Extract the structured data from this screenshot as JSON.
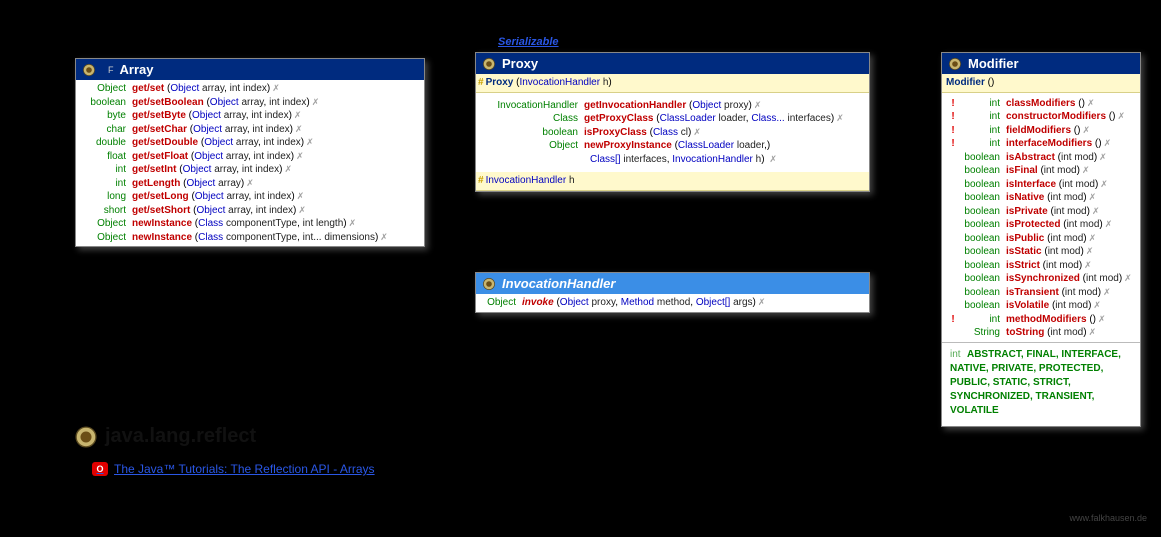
{
  "serializable": "Serializable",
  "package": {
    "name": "java.lang.reflect"
  },
  "tutorial": {
    "text": "The Java™ Tutorials: The Reflection API - Arrays"
  },
  "credit": "www.falkhausen.de",
  "array": {
    "title": "Array",
    "stereotype": "F",
    "rows": [
      {
        "ret": "Object",
        "name": "get/set",
        "args": [
          {
            "t": "Object",
            "p": "array"
          },
          {
            "t": "int",
            "p": "index"
          }
        ]
      },
      {
        "ret": "boolean",
        "name": "get/setBoolean",
        "args": [
          {
            "t": "Object",
            "p": "array"
          },
          {
            "t": "int",
            "p": "index"
          }
        ]
      },
      {
        "ret": "byte",
        "name": "get/setByte",
        "args": [
          {
            "t": "Object",
            "p": "array"
          },
          {
            "t": "int",
            "p": "index"
          }
        ]
      },
      {
        "ret": "char",
        "name": "get/setChar",
        "args": [
          {
            "t": "Object",
            "p": "array"
          },
          {
            "t": "int",
            "p": "index"
          }
        ]
      },
      {
        "ret": "double",
        "name": "get/setDouble",
        "args": [
          {
            "t": "Object",
            "p": "array"
          },
          {
            "t": "int",
            "p": "index"
          }
        ]
      },
      {
        "ret": "float",
        "name": "get/setFloat",
        "args": [
          {
            "t": "Object",
            "p": "array"
          },
          {
            "t": "int",
            "p": "index"
          }
        ]
      },
      {
        "ret": "int",
        "name": "get/setInt",
        "args": [
          {
            "t": "Object",
            "p": "array"
          },
          {
            "t": "int",
            "p": "index"
          }
        ]
      },
      {
        "ret": "int",
        "name": "getLength",
        "args": [
          {
            "t": "Object",
            "p": "array"
          }
        ]
      },
      {
        "ret": "long",
        "name": "get/setLong",
        "args": [
          {
            "t": "Object",
            "p": "array"
          },
          {
            "t": "int",
            "p": "index"
          }
        ]
      },
      {
        "ret": "short",
        "name": "get/setShort",
        "args": [
          {
            "t": "Object",
            "p": "array"
          },
          {
            "t": "int",
            "p": "index"
          }
        ]
      },
      {
        "ret": "Object",
        "name": "newInstance",
        "args": [
          {
            "t": "Class<?>",
            "p": "componentType"
          },
          {
            "t": "int",
            "p": "length"
          }
        ]
      },
      {
        "ret": "Object",
        "name": "newInstance",
        "args": [
          {
            "t": "Class<?>",
            "p": "componentType"
          },
          {
            "t": "int...",
            "p": "dimensions"
          }
        ]
      }
    ]
  },
  "proxy": {
    "title": "Proxy",
    "ctor": {
      "vis": "#",
      "name": "Proxy",
      "args": [
        {
          "t": "InvocationHandler",
          "p": "h"
        }
      ]
    },
    "rows": [
      {
        "ret": "InvocationHandler",
        "name": "getInvocationHandler",
        "args": [
          {
            "t": "Object",
            "p": "proxy"
          }
        ]
      },
      {
        "ret": "Class<?>",
        "name": "getProxyClass",
        "args": [
          {
            "t": "ClassLoader",
            "p": "loader"
          },
          {
            "t": "Class<?>...",
            "p": "interfaces"
          }
        ]
      },
      {
        "ret": "boolean",
        "name": "isProxyClass",
        "args": [
          {
            "t": "Class<?>",
            "p": "cl"
          }
        ]
      },
      {
        "ret": "Object",
        "name": "newProxyInstance",
        "args": [
          {
            "t": "ClassLoader",
            "p": "loader"
          }
        ],
        "cont": [
          {
            "t": "Class<?>[]",
            "p": "interfaces"
          },
          {
            "t": "InvocationHandler",
            "p": "h"
          }
        ]
      }
    ],
    "field": {
      "vis": "#",
      "type": "InvocationHandler",
      "name": "h"
    }
  },
  "invocationHandler": {
    "title": "InvocationHandler",
    "row": {
      "ret": "Object",
      "name": "invoke",
      "args": [
        {
          "t": "Object",
          "p": "proxy"
        },
        {
          "t": "Method",
          "p": "method"
        },
        {
          "t": "Object[]",
          "p": "args"
        }
      ]
    }
  },
  "modifier": {
    "title": "Modifier",
    "ctor": {
      "name": "Modifier",
      "args": []
    },
    "rows": [
      {
        "bang": true,
        "ret": "int",
        "name": "classModifiers",
        "args": []
      },
      {
        "bang": true,
        "ret": "int",
        "name": "constructorModifiers",
        "args": []
      },
      {
        "bang": true,
        "ret": "int",
        "name": "fieldModifiers",
        "args": []
      },
      {
        "bang": true,
        "ret": "int",
        "name": "interfaceModifiers",
        "args": []
      },
      {
        "ret": "boolean",
        "name": "isAbstract",
        "args": [
          {
            "t": "int",
            "p": "mod"
          }
        ]
      },
      {
        "ret": "boolean",
        "name": "isFinal",
        "args": [
          {
            "t": "int",
            "p": "mod"
          }
        ]
      },
      {
        "ret": "boolean",
        "name": "isInterface",
        "args": [
          {
            "t": "int",
            "p": "mod"
          }
        ]
      },
      {
        "ret": "boolean",
        "name": "isNative",
        "args": [
          {
            "t": "int",
            "p": "mod"
          }
        ]
      },
      {
        "ret": "boolean",
        "name": "isPrivate",
        "args": [
          {
            "t": "int",
            "p": "mod"
          }
        ]
      },
      {
        "ret": "boolean",
        "name": "isProtected",
        "args": [
          {
            "t": "int",
            "p": "mod"
          }
        ]
      },
      {
        "ret": "boolean",
        "name": "isPublic",
        "args": [
          {
            "t": "int",
            "p": "mod"
          }
        ]
      },
      {
        "ret": "boolean",
        "name": "isStatic",
        "args": [
          {
            "t": "int",
            "p": "mod"
          }
        ]
      },
      {
        "ret": "boolean",
        "name": "isStrict",
        "args": [
          {
            "t": "int",
            "p": "mod"
          }
        ]
      },
      {
        "ret": "boolean",
        "name": "isSynchronized",
        "args": [
          {
            "t": "int",
            "p": "mod"
          }
        ]
      },
      {
        "ret": "boolean",
        "name": "isTransient",
        "args": [
          {
            "t": "int",
            "p": "mod"
          }
        ]
      },
      {
        "ret": "boolean",
        "name": "isVolatile",
        "args": [
          {
            "t": "int",
            "p": "mod"
          }
        ]
      },
      {
        "bang": true,
        "ret": "int",
        "name": "methodModifiers",
        "args": []
      },
      {
        "ret": "String",
        "name": "toString",
        "args": [
          {
            "t": "int",
            "p": "mod"
          }
        ]
      }
    ],
    "constants_label": "int",
    "constants": "ABSTRACT, FINAL, INTERFACE, NATIVE, PRIVATE, PROTECTED, PUBLIC, STATIC, STRICT, SYNCHRONIZED, TRANSIENT, VOLATILE"
  }
}
